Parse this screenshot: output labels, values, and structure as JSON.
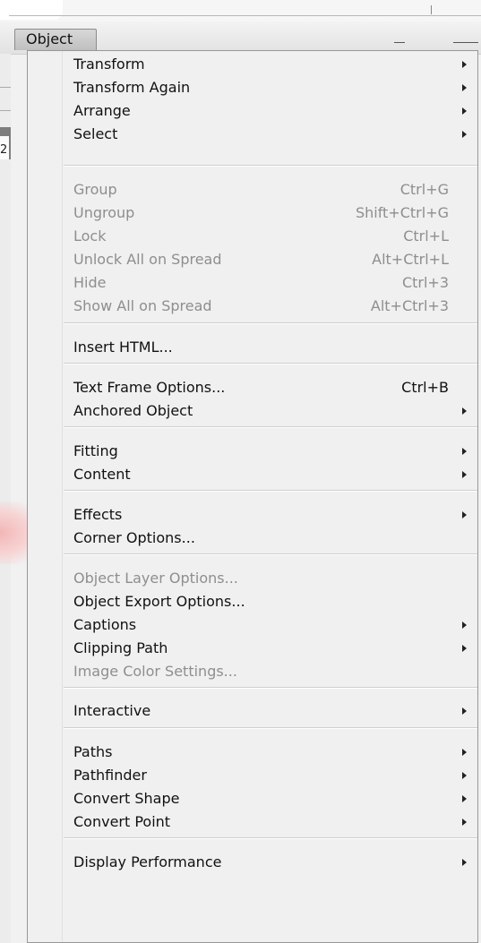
{
  "menubar": {
    "active_menu": "Object"
  },
  "background": {
    "left_char": "2"
  },
  "menu": {
    "items": [
      {
        "label": "Transform",
        "shortcut": "",
        "submenu": true,
        "disabled": false
      },
      {
        "label": "Transform Again",
        "shortcut": "",
        "submenu": true,
        "disabled": false
      },
      {
        "label": "Arrange",
        "shortcut": "",
        "submenu": true,
        "disabled": false
      },
      {
        "label": "Select",
        "shortcut": "",
        "submenu": true,
        "disabled": false
      },
      {
        "label": "Group",
        "shortcut": "Ctrl+G",
        "submenu": false,
        "disabled": true
      },
      {
        "label": "Ungroup",
        "shortcut": "Shift+Ctrl+G",
        "submenu": false,
        "disabled": true
      },
      {
        "label": "Lock",
        "shortcut": "Ctrl+L",
        "submenu": false,
        "disabled": true
      },
      {
        "label": "Unlock All on Spread",
        "shortcut": "Alt+Ctrl+L",
        "submenu": false,
        "disabled": true
      },
      {
        "label": "Hide",
        "shortcut": "Ctrl+3",
        "submenu": false,
        "disabled": true
      },
      {
        "label": "Show All on Spread",
        "shortcut": "Alt+Ctrl+3",
        "submenu": false,
        "disabled": true
      },
      {
        "label": "Insert HTML...",
        "shortcut": "",
        "submenu": false,
        "disabled": false
      },
      {
        "label": "Text Frame Options...",
        "shortcut": "Ctrl+B",
        "submenu": false,
        "disabled": false
      },
      {
        "label": "Anchored Object",
        "shortcut": "",
        "submenu": true,
        "disabled": false
      },
      {
        "label": "Fitting",
        "shortcut": "",
        "submenu": true,
        "disabled": false
      },
      {
        "label": "Content",
        "shortcut": "",
        "submenu": true,
        "disabled": false
      },
      {
        "label": "Effects",
        "shortcut": "",
        "submenu": true,
        "disabled": false
      },
      {
        "label": "Corner Options...",
        "shortcut": "",
        "submenu": false,
        "disabled": false
      },
      {
        "label": "Object Layer Options...",
        "shortcut": "",
        "submenu": false,
        "disabled": true
      },
      {
        "label": "Object Export Options...",
        "shortcut": "",
        "submenu": false,
        "disabled": false
      },
      {
        "label": "Captions",
        "shortcut": "",
        "submenu": true,
        "disabled": false
      },
      {
        "label": "Clipping Path",
        "shortcut": "",
        "submenu": true,
        "disabled": false
      },
      {
        "label": "Image Color Settings...",
        "shortcut": "",
        "submenu": false,
        "disabled": true
      },
      {
        "label": "Interactive",
        "shortcut": "",
        "submenu": true,
        "disabled": false
      },
      {
        "label": "Paths",
        "shortcut": "",
        "submenu": true,
        "disabled": false
      },
      {
        "label": "Pathfinder",
        "shortcut": "",
        "submenu": true,
        "disabled": false
      },
      {
        "label": "Convert Shape",
        "shortcut": "",
        "submenu": true,
        "disabled": false
      },
      {
        "label": "Convert Point",
        "shortcut": "",
        "submenu": true,
        "disabled": false
      },
      {
        "label": "Display Performance",
        "shortcut": "",
        "submenu": true,
        "disabled": false
      }
    ]
  }
}
